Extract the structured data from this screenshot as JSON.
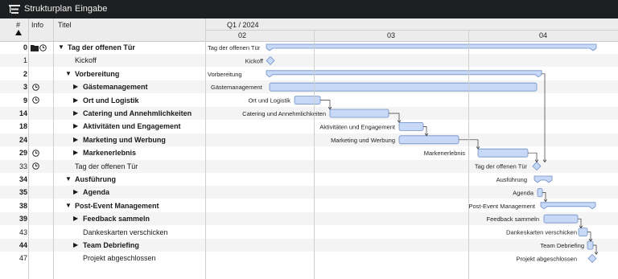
{
  "breadcrumb": {
    "parent": "Strukturplan",
    "current": "Eingabe"
  },
  "columns": {
    "num": "#",
    "info": "Info",
    "title": "Titel"
  },
  "timeline": {
    "quarter": "Q1 / 2024",
    "months": [
      "02",
      "03",
      "04"
    ]
  },
  "rows": [
    {
      "num": "0",
      "title": "Tag der offenen Tür",
      "level": 0,
      "group": true,
      "expanded": true,
      "icons": [
        "folder-icon",
        "clock-icon"
      ],
      "bar_label": "Tag der offenen Tür"
    },
    {
      "num": "1",
      "title": "Kickoff",
      "level": 1,
      "group": false,
      "icons": [],
      "bar_label": "Kickoff"
    },
    {
      "num": "2",
      "title": "Vorbereitung",
      "level": 1,
      "group": true,
      "expanded": true,
      "icons": [],
      "bar_label": "Vorbereitung"
    },
    {
      "num": "3",
      "title": "Gästemanagement",
      "level": 2,
      "group": true,
      "expanded": false,
      "icons": [
        "clock-icon"
      ],
      "bar_label": "Gästemanagement"
    },
    {
      "num": "9",
      "title": "Ort und Logistik",
      "level": 2,
      "group": true,
      "expanded": false,
      "icons": [
        "clock-icon"
      ],
      "bar_label": "Ort und Logistik"
    },
    {
      "num": "14",
      "title": "Catering und Annehmlichkeiten",
      "level": 2,
      "group": true,
      "expanded": false,
      "icons": [],
      "bar_label": "Catering und Annehmlichkeiten"
    },
    {
      "num": "18",
      "title": "Aktivitäten und Engagement",
      "level": 2,
      "group": true,
      "expanded": false,
      "icons": [],
      "bar_label": "Aktivitäten und Engagement"
    },
    {
      "num": "24",
      "title": "Marketing und Werbung",
      "level": 2,
      "group": true,
      "expanded": false,
      "icons": [],
      "bar_label": "Marketing und Werbung"
    },
    {
      "num": "29",
      "title": "Markenerlebnis",
      "level": 2,
      "group": true,
      "expanded": false,
      "icons": [
        "clock-icon"
      ],
      "bar_label": "Markenerlebnis"
    },
    {
      "num": "33",
      "title": "Tag der offenen Tür",
      "level": 1,
      "group": false,
      "icons": [
        "clock-icon"
      ],
      "bar_label": "Tag der offenen Tür"
    },
    {
      "num": "34",
      "title": "Ausführung",
      "level": 1,
      "group": true,
      "expanded": true,
      "icons": [],
      "bar_label": "Ausführung"
    },
    {
      "num": "35",
      "title": "Agenda",
      "level": 2,
      "group": true,
      "expanded": false,
      "icons": [],
      "bar_label": "Agenda"
    },
    {
      "num": "38",
      "title": "Post-Event Management",
      "level": 1,
      "group": true,
      "expanded": true,
      "icons": [],
      "bar_label": "Post-Event Management"
    },
    {
      "num": "39",
      "title": "Feedback sammeln",
      "level": 2,
      "group": true,
      "expanded": false,
      "icons": [],
      "bar_label": "Feedback sammeln"
    },
    {
      "num": "43",
      "title": "Dankeskarten verschicken",
      "level": 2,
      "group": false,
      "icons": [],
      "bar_label": "Dankeskarten verschicken"
    },
    {
      "num": "44",
      "title": "Team Debriefing",
      "level": 2,
      "group": true,
      "expanded": false,
      "icons": [],
      "bar_label": "Team Debriefing"
    },
    {
      "num": "47",
      "title": "Projekt abgeschlossen",
      "level": 2,
      "group": false,
      "icons": [],
      "bar_label": "Projekt abgeschlossen"
    }
  ],
  "colors": {
    "bar_fill": "#c7d9f6",
    "bar_stroke": "#6f8fc4",
    "titlebar": "#1d1f21",
    "header": "#ececec"
  }
}
